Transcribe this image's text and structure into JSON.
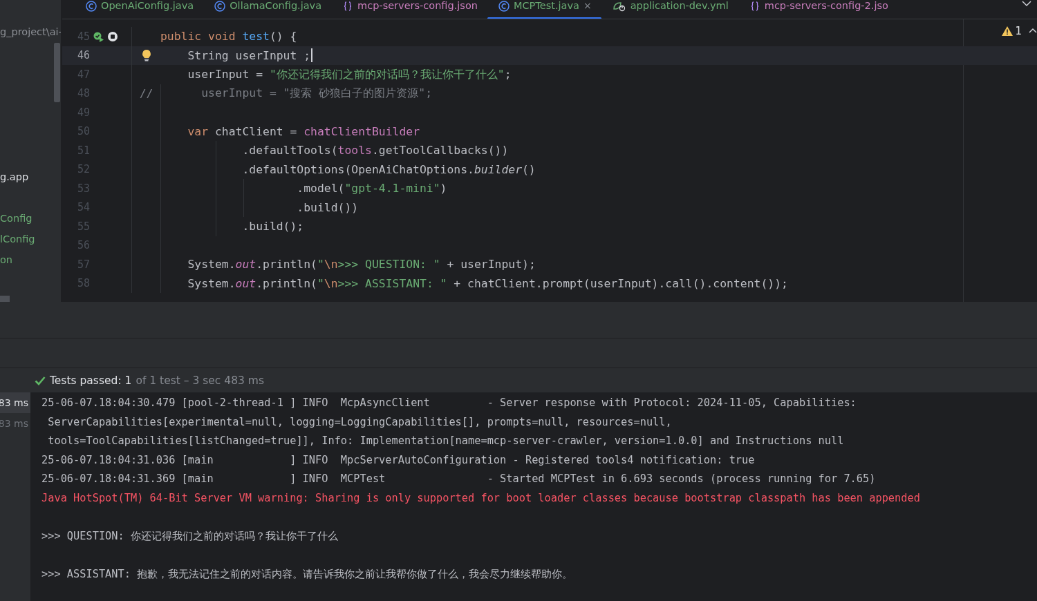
{
  "tabs": [
    {
      "label": "OpenAiConfig.java",
      "kind": "class",
      "selected": false
    },
    {
      "label": "OllamaConfig.java",
      "kind": "class",
      "selected": false
    },
    {
      "label": "mcp-servers-config.json",
      "kind": "json",
      "selected": false
    },
    {
      "label": "MCPTest.java",
      "kind": "class",
      "selected": true,
      "close": "×"
    },
    {
      "label": "application-dev.yml",
      "kind": "yaml",
      "selected": false
    },
    {
      "label": "mcp-servers-config-2.jso",
      "kind": "json",
      "selected": false
    }
  ],
  "sidebar": {
    "items": [
      {
        "label": "g_project\\ai-",
        "kind": "path"
      },
      {
        "label": "g.app",
        "kind": "plain"
      },
      {
        "label": "Config",
        "kind": "modified"
      },
      {
        "label": "lConfig",
        "kind": "modified"
      },
      {
        "label": "on",
        "kind": "modified"
      }
    ]
  },
  "editor": {
    "warning_count": "1",
    "lines": [
      {
        "number": "45",
        "current": false,
        "run_marker": true,
        "tokens": [
          {
            "text": "public void ",
            "kind": "keyword"
          },
          {
            "text": "test",
            "kind": "method"
          },
          {
            "text": "() {",
            "kind": "plain"
          }
        ]
      },
      {
        "number": "46",
        "current": true,
        "run_marker": false,
        "tokens": [
          {
            "text": "    String userInput ;",
            "kind": "plain"
          }
        ]
      },
      {
        "number": "47",
        "current": false,
        "run_marker": false,
        "tokens": [
          {
            "text": "    userInput = ",
            "kind": "plain"
          },
          {
            "text": "\"你还记得我们之前的对话吗？我让你干了什么\"",
            "kind": "string"
          },
          {
            "text": ";",
            "kind": "plain"
          }
        ]
      },
      {
        "number": "48",
        "current": false,
        "run_marker": false,
        "comment_mark": "//",
        "tokens": [
          {
            "text": "      userInput = \"搜索 砂狼白子的图片资源\";",
            "kind": "comment"
          }
        ]
      },
      {
        "number": "49",
        "current": false,
        "run_marker": false
      },
      {
        "number": "50",
        "current": false,
        "run_marker": false,
        "tokens": [
          {
            "text": "    var ",
            "kind": "keyword"
          },
          {
            "text": "chatClient = ",
            "kind": "plain"
          },
          {
            "text": "chatClientBuilder",
            "kind": "field"
          }
        ]
      },
      {
        "number": "51",
        "current": false,
        "run_marker": false,
        "tokens": [
          {
            "text": "            .defaultTools(",
            "kind": "plain"
          },
          {
            "text": "tools",
            "kind": "field"
          },
          {
            "text": ".getToolCallbacks())",
            "kind": "plain"
          }
        ]
      },
      {
        "number": "52",
        "current": false,
        "run_marker": false,
        "tokens": [
          {
            "text": "            .defaultOptions(OpenAiChatOptions.",
            "kind": "plain"
          },
          {
            "text": "builder",
            "kind": "static_method"
          },
          {
            "text": "()",
            "kind": "plain"
          }
        ]
      },
      {
        "number": "53",
        "current": false,
        "run_marker": false,
        "tokens": [
          {
            "text": "                    .model(",
            "kind": "plain"
          },
          {
            "text": "\"gpt-4.1-mini\"",
            "kind": "string"
          },
          {
            "text": ")",
            "kind": "plain"
          }
        ]
      },
      {
        "number": "54",
        "current": false,
        "run_marker": false,
        "tokens": [
          {
            "text": "                    .build())",
            "kind": "plain"
          }
        ]
      },
      {
        "number": "55",
        "current": false,
        "run_marker": false,
        "tokens": [
          {
            "text": "            .build();",
            "kind": "plain"
          }
        ]
      },
      {
        "number": "56",
        "current": false,
        "run_marker": false
      },
      {
        "number": "57",
        "current": false,
        "run_marker": false,
        "tokens": [
          {
            "text": "    System.",
            "kind": "plain"
          },
          {
            "text": "out",
            "kind": "static_field"
          },
          {
            "text": ".println(",
            "kind": "plain"
          },
          {
            "text": "\"",
            "kind": "string"
          },
          {
            "text": "\\n",
            "kind": "escape"
          },
          {
            "text": ">>> QUESTION: \"",
            "kind": "string"
          },
          {
            "text": " + userInput);",
            "kind": "plain"
          }
        ]
      },
      {
        "number": "58",
        "current": false,
        "run_marker": false,
        "tokens": [
          {
            "text": "    System.",
            "kind": "plain"
          },
          {
            "text": "out",
            "kind": "static_field"
          },
          {
            "text": ".println(",
            "kind": "plain"
          },
          {
            "text": "\"",
            "kind": "string"
          },
          {
            "text": "\\n",
            "kind": "escape"
          },
          {
            "text": ">>> ASSISTANT: \"",
            "kind": "string"
          },
          {
            "text": " + chatClient.prompt(userInput).call().content());",
            "kind": "plain"
          }
        ]
      }
    ]
  },
  "run_panel": {
    "status": "Tests passed: 1",
    "detail": "of 1 test – 3 sec 483 ms",
    "durations": [
      {
        "text": "83 ms",
        "selected": true
      },
      {
        "text": "83 ms",
        "selected": false
      }
    ],
    "console": [
      {
        "kind": "log",
        "text": "25-06-07.18:04:30.479 [pool-2-thread-1 ] INFO  McpAsyncClient         - Server response with Protocol: 2024-11-05, Capabilities:"
      },
      {
        "kind": "log",
        "text": " ServerCapabilities[experimental=null, logging=LoggingCapabilities[], prompts=null, resources=null,"
      },
      {
        "kind": "log",
        "text": " tools=ToolCapabilities[listChanged=true]], Info: Implementation[name=mcp-server-crawler, version=1.0.0] and Instructions null"
      },
      {
        "kind": "log",
        "text": "25-06-07.18:04:31.036 [main            ] INFO  MpcServerAutoConfiguration - Registered tools4 notification: true"
      },
      {
        "kind": "log",
        "text": "25-06-07.18:04:31.369 [main            ] INFO  MCPTest                - Started MCPTest in 6.693 seconds (process running for 7.65)"
      },
      {
        "kind": "error",
        "text": "Java HotSpot(TM) 64-Bit Server VM warning: Sharing is only supported for boot loader classes because bootstrap classpath has been appended"
      },
      {
        "kind": "blank"
      },
      {
        "kind": "log",
        "text": ">>> QUESTION: 你还记得我们之前的对话吗？我让你干了什么"
      },
      {
        "kind": "blank"
      },
      {
        "kind": "log",
        "text": ">>> ASSISTANT: 抱歉，我无法记住之前的对话内容。请告诉我你之前让我帮你做了什么，我会尽力继续帮助你。"
      }
    ]
  }
}
